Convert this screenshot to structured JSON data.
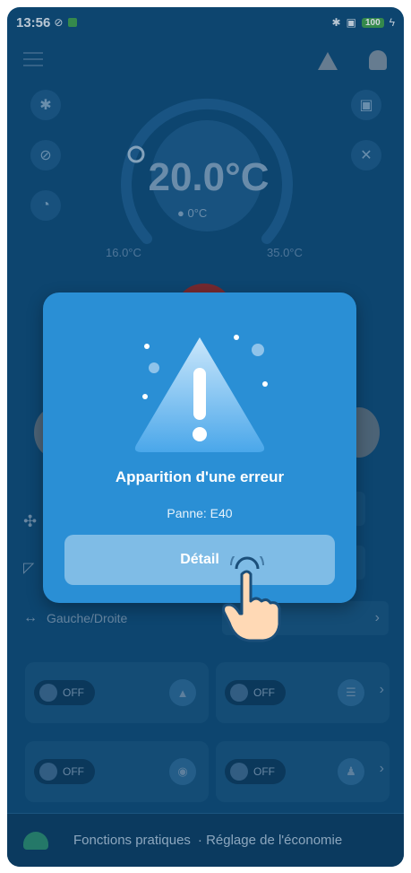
{
  "status_bar": {
    "time": "13:56",
    "battery": "100"
  },
  "thermostat": {
    "set_temperature": "20.0°C",
    "indoor_temperature": "0°C",
    "range_min": "16.0°C",
    "range_max": "35.0°C"
  },
  "controls": {
    "swing_label": "Gauche/Droite"
  },
  "cards": [
    {
      "toggle": "OFF"
    },
    {
      "toggle": "OFF"
    },
    {
      "toggle": "OFF"
    },
    {
      "toggle": "OFF"
    }
  ],
  "bottom_bar": {
    "items": [
      "Fonctions pratiques",
      "Réglage de l'économie"
    ]
  },
  "modal": {
    "title": "Apparition d'une erreur",
    "subtitle": "Panne: E40",
    "detail_button": "Détail"
  },
  "colors": {
    "background": "#0e4c78",
    "modal": "#2a8fd5",
    "button": "#7fbce6"
  }
}
